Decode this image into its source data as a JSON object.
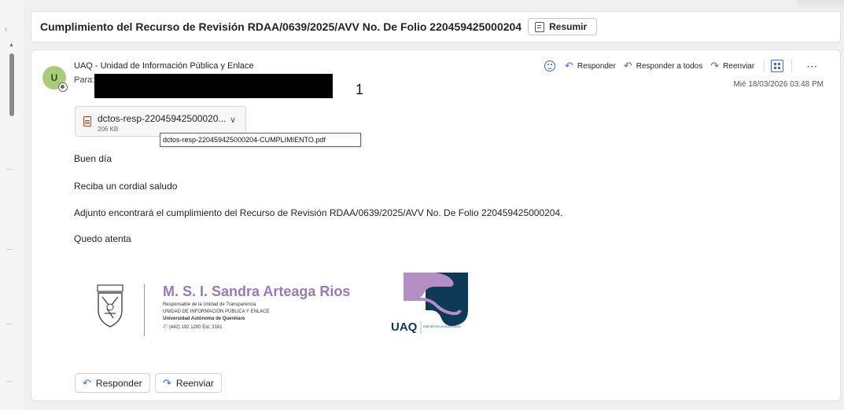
{
  "subject": {
    "title": "Cumplimiento del Recurso de Revisión RDAA/0639/2025/AVV No. De Folio 220459425000204",
    "summarize_label": "Resumir"
  },
  "message": {
    "avatar_initial": "U",
    "sender": "UAQ - Unidad de Información Pública y Enlace",
    "to_label": "Para:",
    "recipient_count": "1",
    "date": "Mié 18/03/2026 03:48 PM",
    "actions": {
      "reply": "Responder",
      "reply_all": "Responder a todos",
      "forward": "Reenviar"
    },
    "attachment": {
      "name": "dctos-resp-22045942500020...",
      "size": "206 KB",
      "tooltip": "dctos-resp-220459425000204-CUMPLIMIENTO.pdf",
      "icon": "pdf-icon"
    },
    "body": [
      "Buen día",
      "Reciba un cordial saludo",
      "Adjunto encontrará el cumplimiento del Recurso de Revisión RDAA/0639/2025/AVV No. De Folio 220459425000204.",
      "Quedo atenta"
    ],
    "signature": {
      "name": "M. S. I. Sandra Arteaga Rios",
      "role": "Responsable de la Unidad de Transparencia",
      "unit": "UNIDAD DE INFORMACIÓN PÚBLICA Y ENLACE",
      "university": "Universidad Autónoma de Querétaro",
      "phone": "(442) 192 1200 Ext. 3161",
      "logo_text": "UAQ",
      "logo_tagline": "CRECER EN LA DIVERSIDAD"
    },
    "footer": {
      "reply": "Responder",
      "forward": "Reenviar"
    }
  },
  "colors": {
    "accent": "#3b6cc7",
    "signature_purple": "#9b79b9",
    "logo_navy": "#0e3a5a",
    "avatar_green": "#a8cc7a"
  }
}
